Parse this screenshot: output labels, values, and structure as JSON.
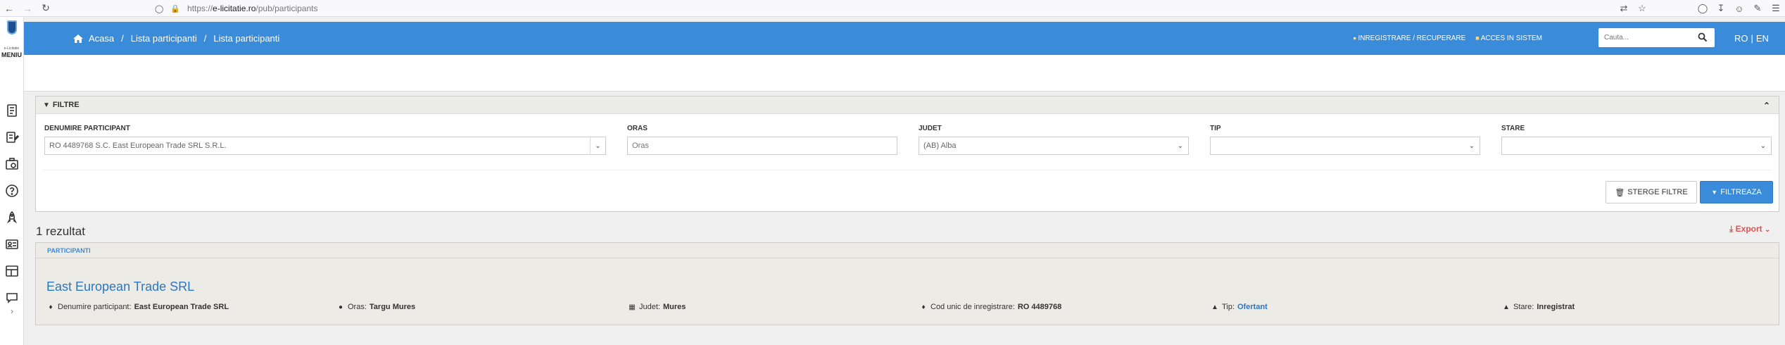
{
  "browser": {
    "url_prefix": "https://",
    "url_domain": "e-licitatie.ro",
    "url_path": "/pub/participants"
  },
  "sidebar": {
    "small_text": "e-Licitatie",
    "menu_label": "MENIU",
    "icons": [
      "document-icon",
      "edit-list-icon",
      "briefcase-icon",
      "help-icon",
      "rocket-icon",
      "id-card-icon",
      "dashboard-icon",
      "chat-icon"
    ]
  },
  "header": {
    "breadcrumb": [
      "Acasa",
      "Lista participanti",
      "Lista participanti"
    ],
    "register_link": "INREGISTRARE / RECUPERARE",
    "login_link": "ACCES IN SISTEM",
    "search_placeholder": "Cauta...",
    "lang_ro": "RO",
    "lang_sep": "|",
    "lang_en": "EN"
  },
  "filters": {
    "title": "FILTRE",
    "fields": [
      {
        "label": "DENUMIRE PARTICIPANT",
        "value": "RO 4489768 S.C. East European Trade SRL S.R.L."
      },
      {
        "label": "ORAS",
        "placeholder": "Oras",
        "value": ""
      },
      {
        "label": "JUDET",
        "value": "(AB) Alba"
      },
      {
        "label": "TIP",
        "value": ""
      },
      {
        "label": "STARE",
        "value": ""
      }
    ],
    "clear_button": "STERGE FILTRE",
    "filter_button": "FILTREAZA"
  },
  "results": {
    "count_text": "1 rezultat",
    "export_label": "Export",
    "panel_title": "PARTICIPANTI",
    "items": [
      {
        "name": "East European Trade SRL",
        "details": [
          {
            "label": "Denumire participant:",
            "value": "East European Trade SRL"
          },
          {
            "label": "Oras:",
            "value": "Targu Mures"
          },
          {
            "label": "Judet:",
            "value": "Mures"
          },
          {
            "label": "Cod unic de inregistrare:",
            "value": "RO 4489768"
          },
          {
            "label": "Tip:",
            "value": "Ofertant"
          },
          {
            "label": "Stare:",
            "value": "Inregistrat"
          }
        ]
      }
    ]
  },
  "colors": {
    "header_blue": "#3a8bd9",
    "link_blue": "#2a77c2",
    "export_red": "#d9534f"
  }
}
